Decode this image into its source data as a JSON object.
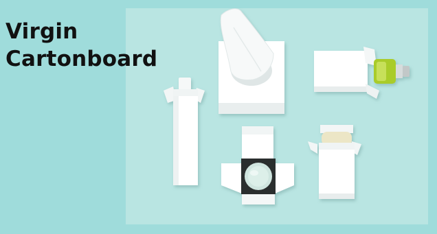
{
  "heading": {
    "line1": "Virgin",
    "line2": "Cartonboard"
  },
  "image": {
    "subject": "white cartonboard packaging boxes on teal background",
    "items": [
      "tissue-box",
      "tube-box",
      "bottle-box",
      "jar-box",
      "soap-box"
    ]
  },
  "colors": {
    "page_background": "#9fdcdb",
    "photo_background": "#b9e5e2",
    "carton_white": "#ffffff",
    "bottle_green": "#a9cc2c",
    "text": "#111111"
  }
}
